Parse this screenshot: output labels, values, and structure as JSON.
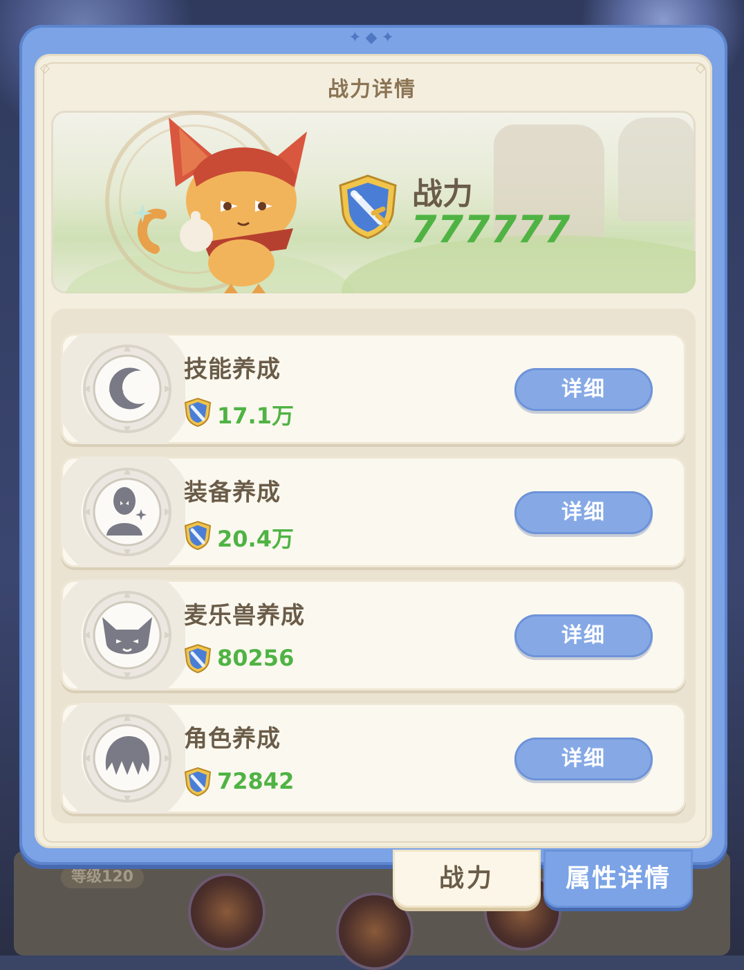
{
  "panel": {
    "title": "战力详情"
  },
  "summary": {
    "power_label": "战力",
    "power_value": "777777"
  },
  "items": [
    {
      "name": "技能养成",
      "value": "17.1万",
      "button": "详细",
      "icon": "moon-star-icon"
    },
    {
      "name": "装备养成",
      "value": "20.4万",
      "button": "详细",
      "icon": "armor-figure-icon"
    },
    {
      "name": "麦乐兽养成",
      "value": "80256",
      "button": "详细",
      "icon": "cat-face-icon"
    },
    {
      "name": "角色养成",
      "value": "72842",
      "button": "详细",
      "icon": "hair-portrait-icon"
    }
  ],
  "tabs": [
    {
      "label": "战力",
      "active": true
    },
    {
      "label": "属性详情",
      "active": false
    }
  ],
  "background": {
    "level_badge": "等级120"
  },
  "colors": {
    "frame_blue": "#7ba3e6",
    "panel_cream": "#f4eedf",
    "value_green": "#4fb344",
    "text_brown": "#6a5c48"
  }
}
